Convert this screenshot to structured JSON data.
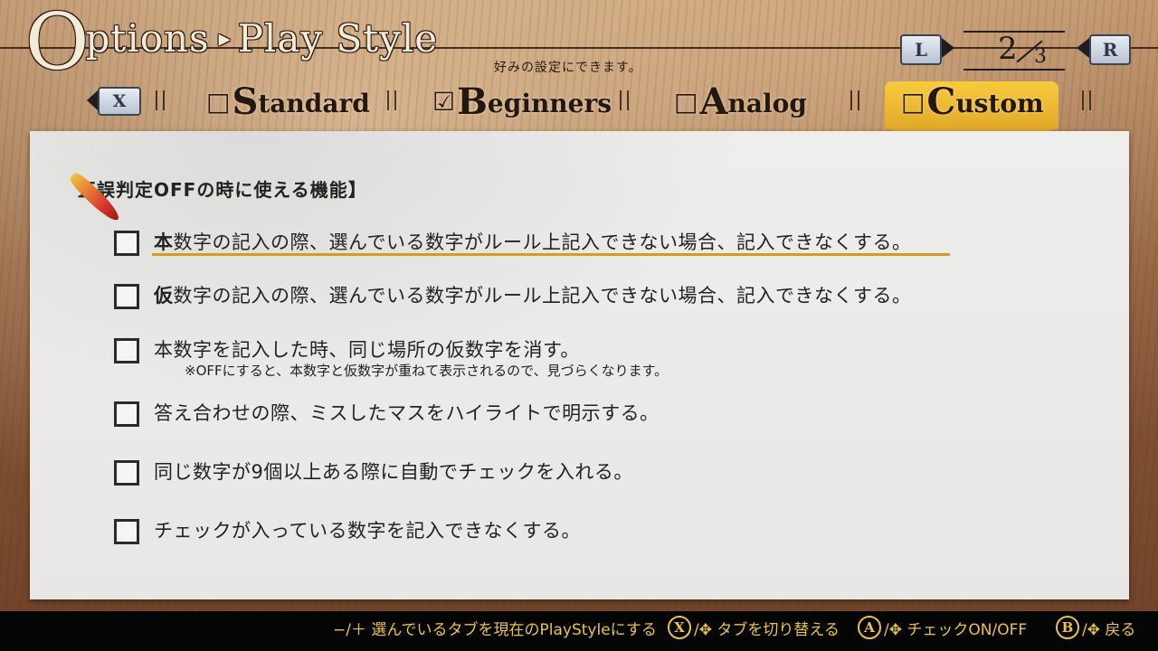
{
  "header": {
    "title_first": "O",
    "title_rest": "ptions",
    "title_arrow": "▸",
    "title_section": "Play Style",
    "subtitle": "好みの設定にできます。"
  },
  "pager": {
    "left_button": "L",
    "right_button": "R",
    "current": "2",
    "total": "3"
  },
  "tabs": {
    "switch_button": "X",
    "items": [
      {
        "checkbox": "□",
        "cap": "S",
        "rest": "tandard",
        "checked": false
      },
      {
        "checkbox": "☑",
        "cap": "B",
        "rest": "eginners",
        "checked": true
      },
      {
        "checkbox": "□",
        "cap": "A",
        "rest": "nalog",
        "checked": false
      },
      {
        "checkbox": "□",
        "cap": "C",
        "rest": "ustom",
        "checked": false,
        "selected": true
      }
    ],
    "accent_color": "#f2c13a"
  },
  "section": {
    "title": "正誤判定OFFの時に使える機能】"
  },
  "options": [
    {
      "bold": "本",
      "text": "数字の記入の際、選んでいる数字がルール上記入できない場合、記入できなくする。",
      "checked": false,
      "focused": true
    },
    {
      "bold": "仮",
      "text": "数字の記入の際、選んでいる数字がルール上記入できない場合、記入できなくする。",
      "checked": false
    },
    {
      "bold": "",
      "text": "本数字を記入した時、同じ場所の仮数字を消す。",
      "note": "※OFFにすると、本数字と仮数字が重ねて表示されるので、見づらくなります。",
      "checked": false
    },
    {
      "bold": "",
      "text": "答え合わせの際、ミスしたマスをハイライトで明示する。",
      "checked": false
    },
    {
      "bold": "",
      "text": "同じ数字が9個以上ある際に自動でチェックを入れる。",
      "checked": false
    },
    {
      "bold": "",
      "text": "チェックが入っている数字を記入できなくする。",
      "checked": false
    }
  ],
  "footer": {
    "hint1": "−/＋ 選んでいるタブを現在のPlayStyleにする",
    "hint2_button": "X",
    "hint2": "/✥ タブを切り替える",
    "hint3_button": "A",
    "hint3": "/✥ チェックON/OFF",
    "hint4_button": "B",
    "hint4": "/✥ 戻る",
    "color": "#e9c24a"
  }
}
